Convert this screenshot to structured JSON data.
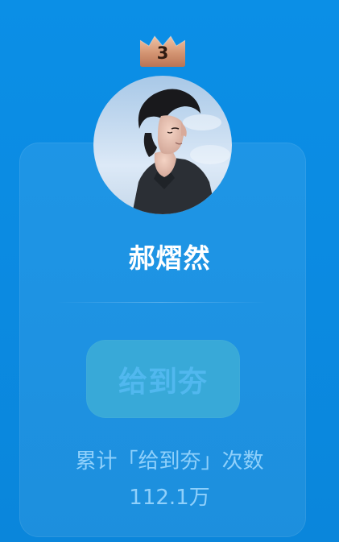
{
  "profile": {
    "rank_badge": "3",
    "name": "郝熠然",
    "avatar_icon": "avatar-photo-icon"
  },
  "action": {
    "cheer_label": "给到夯"
  },
  "stats": {
    "label": "累计「给到夯」次数",
    "value": "112.1万"
  },
  "colors": {
    "background": "#0b8de3",
    "card": "#1b96ea",
    "button": "#38a9d8",
    "button_text": "#51b8ef",
    "stats_text": "#8fd0fb",
    "name_text": "#ffffff",
    "crown": "#c88960"
  }
}
